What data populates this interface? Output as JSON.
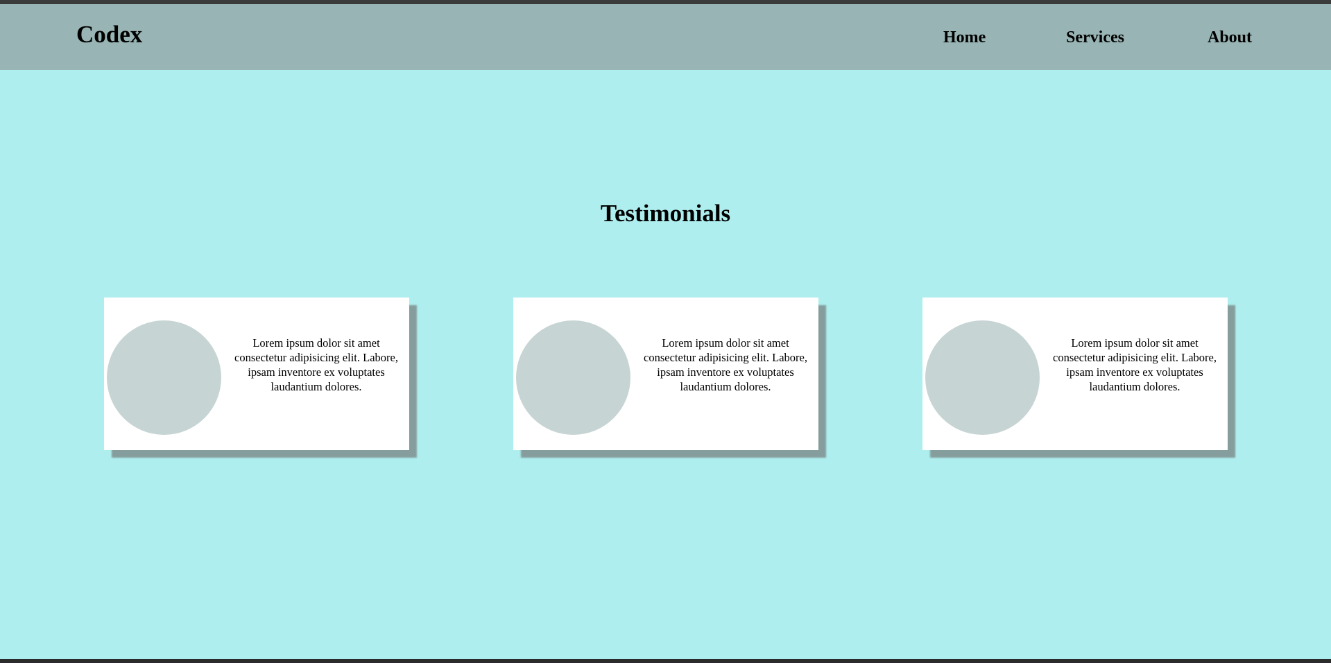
{
  "brand": {
    "name": "Codex"
  },
  "nav": {
    "items": [
      {
        "label": "Home"
      },
      {
        "label": "Services"
      },
      {
        "label": "About"
      }
    ]
  },
  "testimonials": {
    "title": "Testimonials",
    "cards": [
      {
        "text": "Lorem ipsum dolor sit amet consectetur adipisicing elit. Labore, ipsam inventore ex voluptates laudantium dolores."
      },
      {
        "text": "Lorem ipsum dolor sit amet consectetur adipisicing elit. Labore, ipsam inventore ex voluptates laudantium dolores."
      },
      {
        "text": "Lorem ipsum dolor sit amet consectetur adipisicing elit. Labore, ipsam inventore ex voluptates laudantium dolores."
      }
    ]
  },
  "colors": {
    "page_background": "#afeeee",
    "navbar_background": "#98b4b4",
    "card_background": "#ffffff",
    "avatar_placeholder": "#c7d4d4"
  }
}
